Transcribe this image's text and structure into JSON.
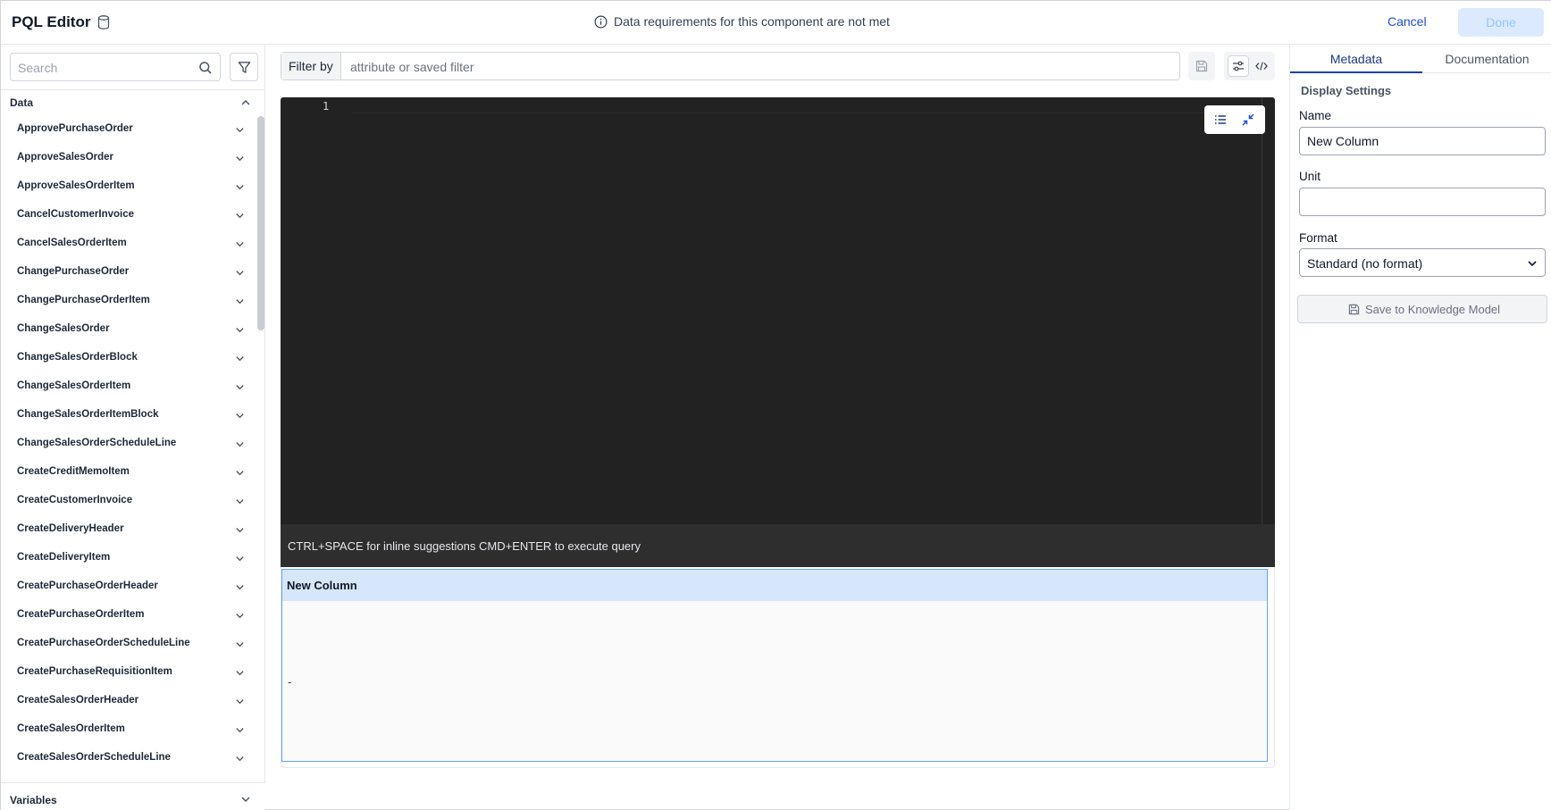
{
  "header": {
    "title": "PQL Editor",
    "warning": "Data requirements for this component are not met",
    "cancel_label": "Cancel",
    "done_label": "Done"
  },
  "sidebar": {
    "search_placeholder": "Search",
    "data_section_label": "Data",
    "items": [
      {
        "label": "ApprovePurchaseOrder"
      },
      {
        "label": "ApproveSalesOrder"
      },
      {
        "label": "ApproveSalesOrderItem"
      },
      {
        "label": "CancelCustomerInvoice"
      },
      {
        "label": "CancelSalesOrderItem"
      },
      {
        "label": "ChangePurchaseOrder"
      },
      {
        "label": "ChangePurchaseOrderItem"
      },
      {
        "label": "ChangeSalesOrder"
      },
      {
        "label": "ChangeSalesOrderBlock"
      },
      {
        "label": "ChangeSalesOrderItem"
      },
      {
        "label": "ChangeSalesOrderItemBlock"
      },
      {
        "label": "ChangeSalesOrderScheduleLine"
      },
      {
        "label": "CreateCreditMemoItem"
      },
      {
        "label": "CreateCustomerInvoice"
      },
      {
        "label": "CreateDeliveryHeader"
      },
      {
        "label": "CreateDeliveryItem"
      },
      {
        "label": "CreatePurchaseOrderHeader"
      },
      {
        "label": "CreatePurchaseOrderItem"
      },
      {
        "label": "CreatePurchaseOrderScheduleLine"
      },
      {
        "label": "CreatePurchaseRequisitionItem"
      },
      {
        "label": "CreateSalesOrderHeader"
      },
      {
        "label": "CreateSalesOrderItem"
      },
      {
        "label": "CreateSalesOrderScheduleLine"
      }
    ],
    "variables_section_label": "Variables"
  },
  "filter": {
    "label": "Filter by",
    "placeholder": "attribute or saved filter"
  },
  "editor": {
    "line_number": "1",
    "hint": "CTRL+SPACE for inline suggestions CMD+ENTER to execute query"
  },
  "results": {
    "column_header": "New Column",
    "cell_value": "-"
  },
  "right_panel": {
    "tabs": [
      "Metadata",
      "Documentation"
    ],
    "active_tab": "Metadata",
    "display_settings_title": "Display Settings",
    "name_label": "Name",
    "name_value": "New Column",
    "unit_label": "Unit",
    "unit_value": "",
    "format_label": "Format",
    "format_value": "Standard (no format)",
    "save_km_label": "Save to Knowledge Model"
  },
  "colors": {
    "accent": "#1e40af",
    "editor_bg": "#222222",
    "result_header_bg": "#d6e6fb",
    "done_bg": "#dbeafe"
  }
}
